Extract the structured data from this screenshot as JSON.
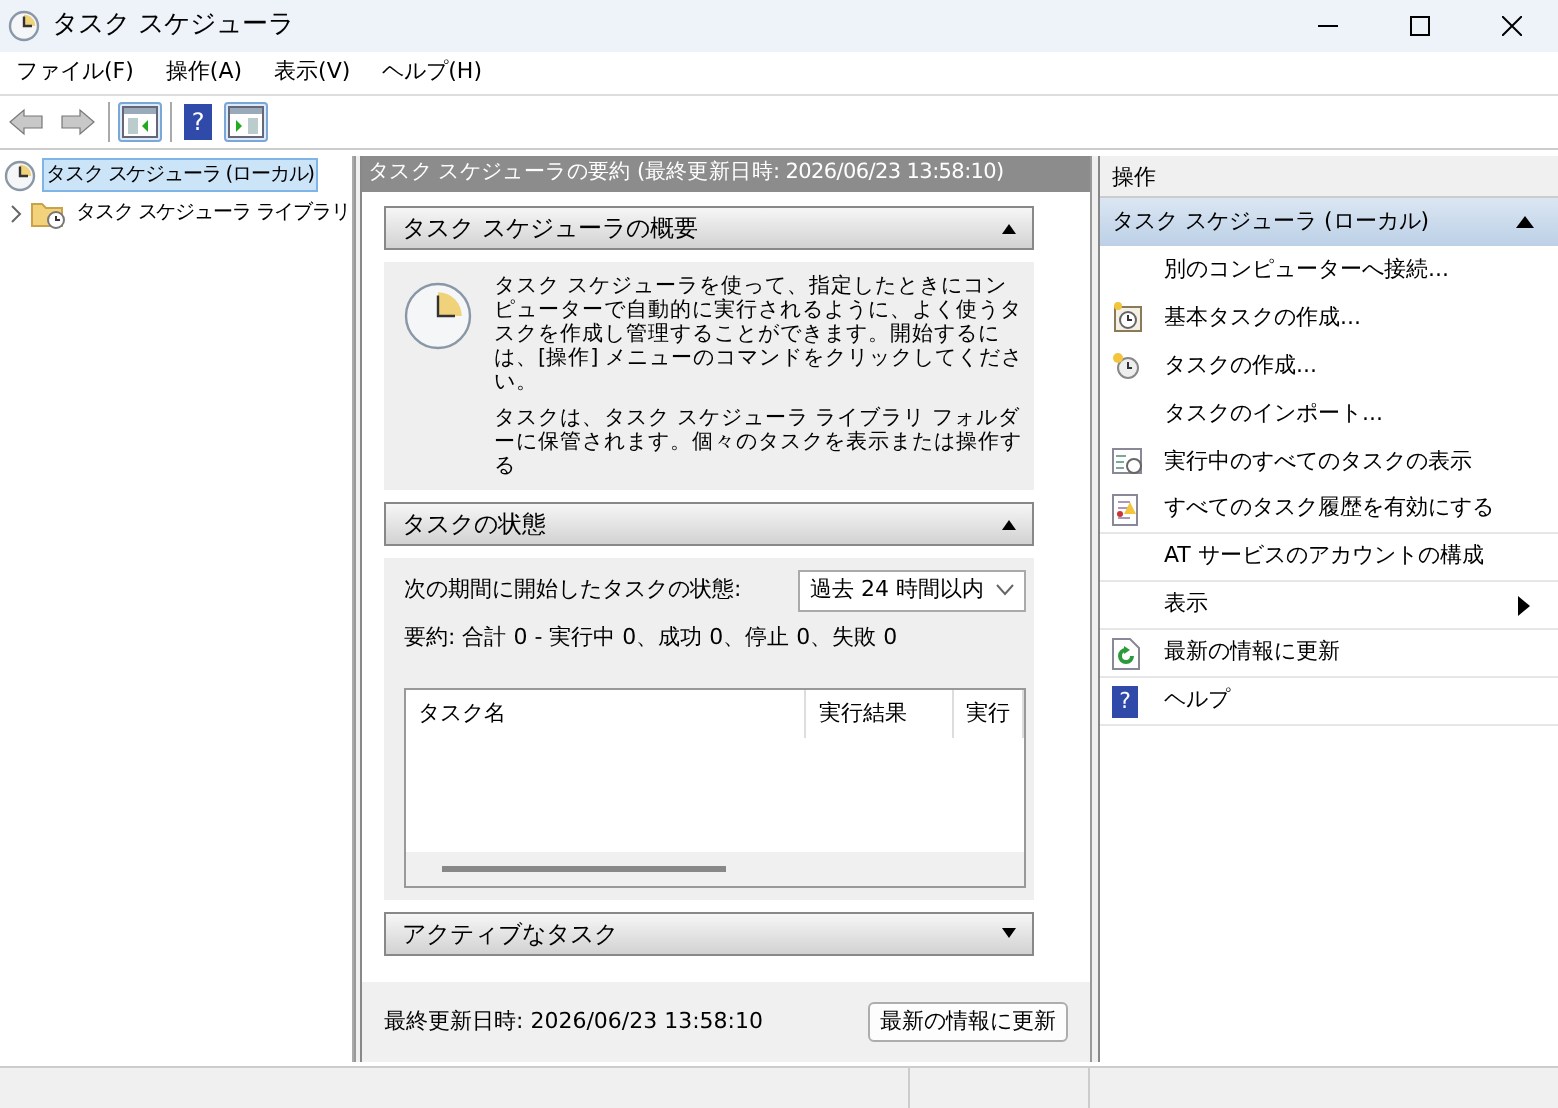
{
  "window": {
    "title": "タスク スケジューラ"
  },
  "menu": [
    "ファイル(F)",
    "操作(A)",
    "表示(V)",
    "ヘルプ(H)"
  ],
  "toolbar": [
    {
      "kind": "back",
      "disabled": true
    },
    {
      "kind": "forward",
      "disabled": true
    },
    {
      "kind": "sep"
    },
    {
      "kind": "left-pane",
      "selected": true
    },
    {
      "kind": "sep"
    },
    {
      "kind": "help",
      "selected": false,
      "glyph": "?"
    },
    {
      "kind": "right-pane",
      "selected": true
    }
  ],
  "tree": [
    {
      "label": "タスク スケジューラ (ローカル)",
      "selected": true,
      "children": [
        {
          "label": "タスク スケジューラ ライブラリ",
          "selected": false,
          "expanded": false
        }
      ]
    }
  ],
  "summary": {
    "title": "タスク スケジューラの要約 (最終更新日時: 2026/06/23 13:58:10)",
    "sections": [
      {
        "kind": "overview",
        "title": "タスク スケジューラの概要",
        "expanded": true,
        "paragraphs": [
          "タスク スケジューラを使って、指定したときにコンピューターで自動的に実行されるように、よく使うタスクを作成し管理することができます。開始するには、[操作] メニューのコマンドをクリックしてください。",
          "タスクは、タスク スケジューラ ライブラリ フォルダーに保管されます。個々のタスクを表示または操作する"
        ]
      },
      {
        "kind": "status",
        "title": "タスクの状態",
        "expanded": true,
        "period_label": "次の期間に開始したタスクの状態:",
        "period": "過去 24 時間以内",
        "summary": "要約: 合計 0 - 実行中 0、成功 0、停止 0、失敗 0",
        "columns": [
          "タスク名",
          "実行結果",
          "実行"
        ]
      },
      {
        "kind": "active",
        "title": "アクティブなタスク",
        "expanded": false
      }
    ],
    "last_updated": "最終更新日時: 2026/06/23 13:58:10",
    "refresh_button": "最新の情報に更新"
  },
  "actions": {
    "title": "操作",
    "group": {
      "title": "タスク スケジューラ (ローカル)",
      "expanded": true
    },
    "items": [
      {
        "label": "別のコンピューターへ接続...",
        "submenu": false
      },
      {
        "label": "基本タスクの作成...",
        "submenu": false
      },
      {
        "label": "タスクの作成...",
        "submenu": false
      },
      {
        "label": "タスクのインポート...",
        "submenu": false
      },
      {
        "label": "実行中のすべてのタスクの表示",
        "submenu": false
      },
      {
        "label": "すべてのタスク履歴を有効にする",
        "submenu": false
      },
      {
        "label": "AT サービスのアカウントの構成",
        "submenu": false
      },
      {
        "label": "表示",
        "submenu": true
      },
      {
        "label": "最新の情報に更新",
        "submenu": false
      },
      {
        "label": "ヘルプ",
        "submenu": false,
        "glyph": "?"
      }
    ]
  }
}
